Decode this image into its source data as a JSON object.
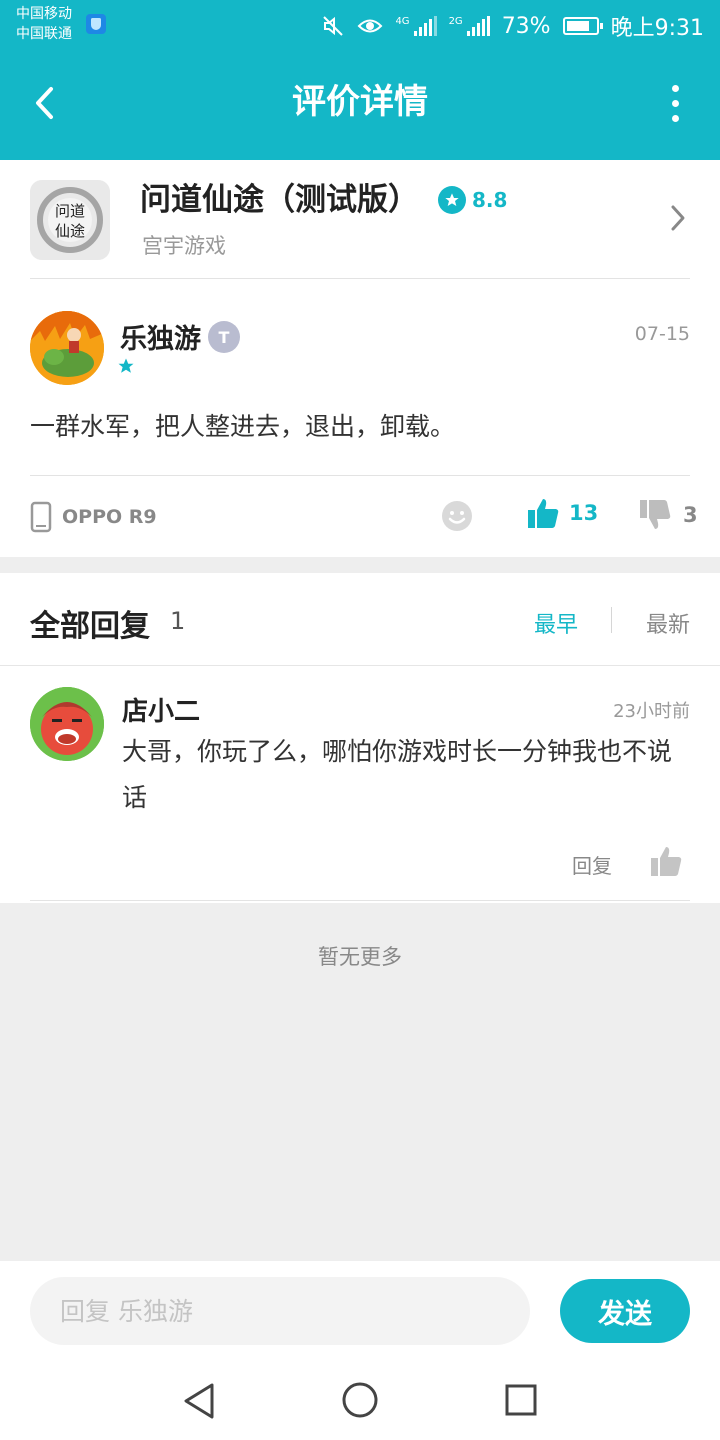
{
  "status_bar": {
    "carrier_1": "中国移动",
    "carrier_2": "中国联通",
    "net_1": "4G",
    "net_2": "2G",
    "battery": "73%",
    "time": "晚上9:31"
  },
  "header": {
    "title": "评价详情",
    "back_icon": "chevron-left-icon",
    "more_icon": "more-vertical-icon"
  },
  "game": {
    "name": "问道仙途（测试版）",
    "rating": "8.8",
    "developer": "宫宇游戏",
    "icon_text": [
      "问道",
      "仙途"
    ]
  },
  "review": {
    "author": "乐独游",
    "level_badge": "T",
    "date": "07-15",
    "content": "一群水军，把人整进去，退出，卸载。",
    "device": "OPPO R9",
    "likes": "13",
    "dislikes": "3"
  },
  "replies_section": {
    "title": "全部回复",
    "count": "1",
    "sort_earliest": "最早",
    "sort_newest": "最新"
  },
  "replies": [
    {
      "author": "店小二",
      "time": "23小时前",
      "content": "大哥，你玩了么，哪怕你游戏时长一分钟我也不说话",
      "reply_label": "回复"
    }
  ],
  "empty_state": "暂无更多",
  "composer": {
    "placeholder": "回复 乐独游",
    "send_label": "发送"
  },
  "colors": {
    "accent": "#14b7c7",
    "background_gray": "#eeeeee",
    "muted_text": "#999999"
  }
}
